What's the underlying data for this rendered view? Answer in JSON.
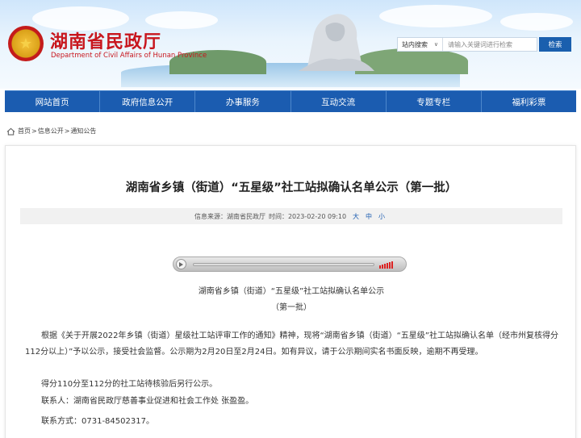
{
  "header": {
    "site_title": "湖南省民政厅",
    "site_subtitle": "Department of Civil Affairs of Hunan Province",
    "search": {
      "scope_label": "站内搜索",
      "placeholder": "请输入关键词进行检索",
      "button_label": "检索"
    }
  },
  "nav": {
    "items": [
      "网站首页",
      "政府信息公开",
      "办事服务",
      "互动交流",
      "专题专栏",
      "福利彩票"
    ]
  },
  "breadcrumb": {
    "items": [
      "首页",
      "信息公开",
      "通知公告"
    ],
    "separator": ">"
  },
  "article": {
    "title": "湖南省乡镇（街道）“五星级”社工站拟确认名单公示（第一批）",
    "meta": {
      "source": "信息来源：湖南省民政厅",
      "time": "时间：2023-02-20 09:10",
      "size_large": "大",
      "size_medium": "中",
      "size_small": "小"
    },
    "doc_heading_line1": "湖南省乡镇（街道）“五星级”社工站拟确认名单公示",
    "doc_heading_line2": "（第一批）",
    "paragraph1": "根据《关于开展2022年乡镇（街道）星级社工站评审工作的通知》精神，现将“湖南省乡镇（街道）“五星级”社工站拟确认名单（经市州复核得分112分以上）”予以公示，接受社会监督。公示期为2月20日至2月24日。如有异议，请于公示期间实名书面反映，逾期不再受理。",
    "line2": "得分110分至112分的社工站待核验后另行公示。",
    "line3": "联系人：湖南省民政厅慈善事业促进和社会工作处 张盈盈。",
    "line4": "联系方式：0731-84502317。"
  },
  "colors": {
    "brand_red": "#c8161d",
    "nav_blue": "#1b5cb0"
  }
}
